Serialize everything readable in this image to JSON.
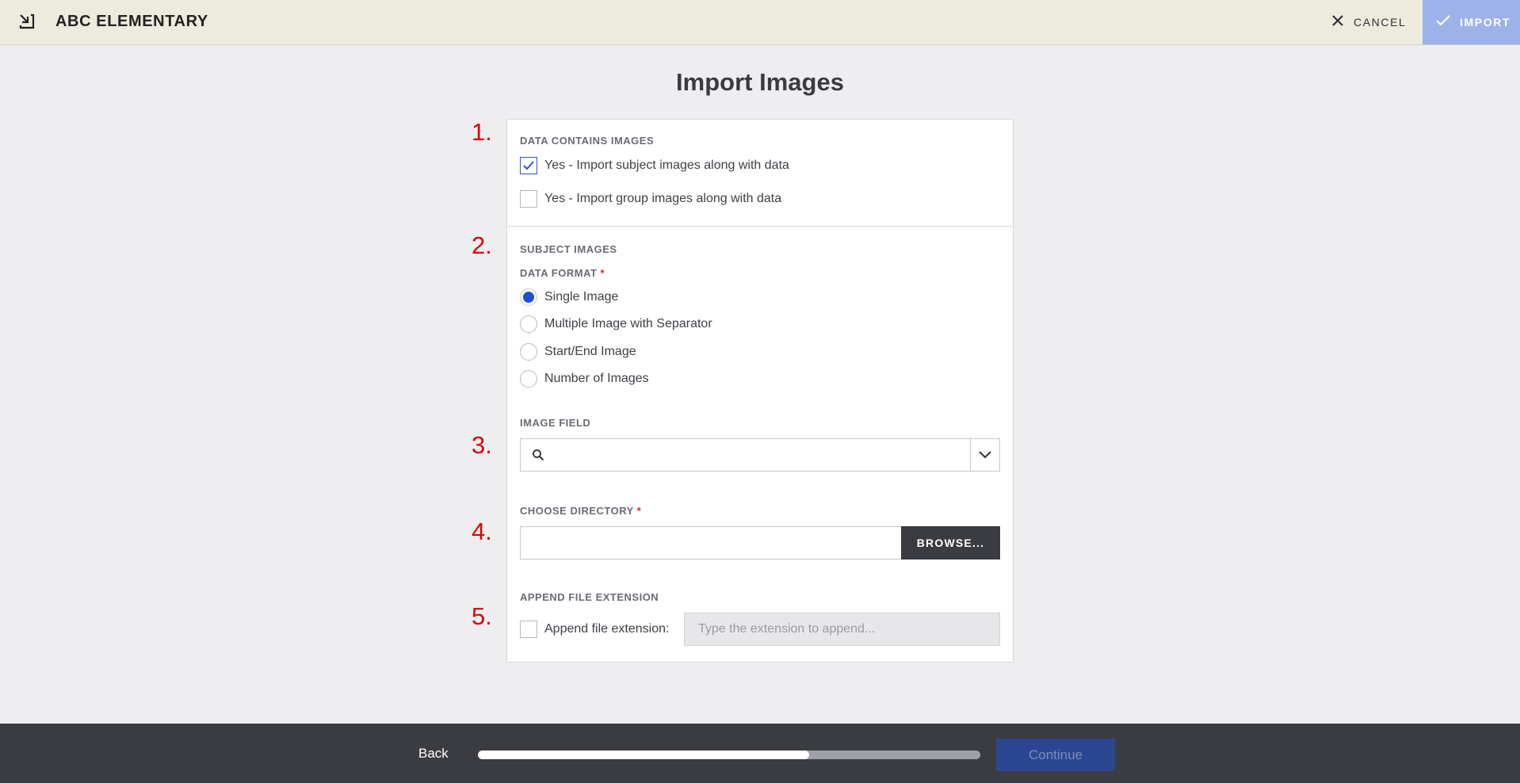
{
  "header": {
    "app_title": "ABC ELEMENTARY",
    "cancel_label": "CANCEL",
    "import_label": "IMPORT",
    "import_icon": "import-arrow-icon",
    "cancel_icon": "close-icon",
    "confirm_icon": "checkmark-icon"
  },
  "page": {
    "title": "Import Images"
  },
  "steps": [
    "1.",
    "2.",
    "3.",
    "4.",
    "5."
  ],
  "data_contains_images": {
    "label": "DATA CONTAINS IMAGES",
    "options": [
      {
        "label": "Yes - Import subject images along with data",
        "checked": true
      },
      {
        "label": "Yes - Import group images along with data",
        "checked": false
      }
    ]
  },
  "subject_images": {
    "label": "SUBJECT IMAGES",
    "format_label": "DATA FORMAT",
    "required_mark": "*",
    "formats": [
      {
        "label": "Single Image",
        "selected": true
      },
      {
        "label": "Multiple Image with Separator",
        "selected": false
      },
      {
        "label": "Start/End Image",
        "selected": false
      },
      {
        "label": "Number of Images",
        "selected": false
      }
    ]
  },
  "image_field": {
    "label": "IMAGE FIELD",
    "value": "",
    "search_icon": "search-icon",
    "caret_icon": "chevron-down-icon"
  },
  "choose_directory": {
    "label": "CHOOSE DIRECTORY",
    "required_mark": "*",
    "value": "",
    "browse_label": "BROWSE..."
  },
  "append_extension": {
    "label": "APPEND FILE EXTENSION",
    "checkbox_label": "Append file extension:",
    "checked": false,
    "placeholder": "Type the extension to append..."
  },
  "footer": {
    "back_label": "Back",
    "continue_label": "Continue",
    "progress_fraction": 0.66
  },
  "colors": {
    "accent": "#1d4fd8",
    "step_number": "#e00000",
    "import_button": "#9db2e9",
    "footer_bg": "#3b3c42",
    "continue_bg": "#2b4693"
  }
}
